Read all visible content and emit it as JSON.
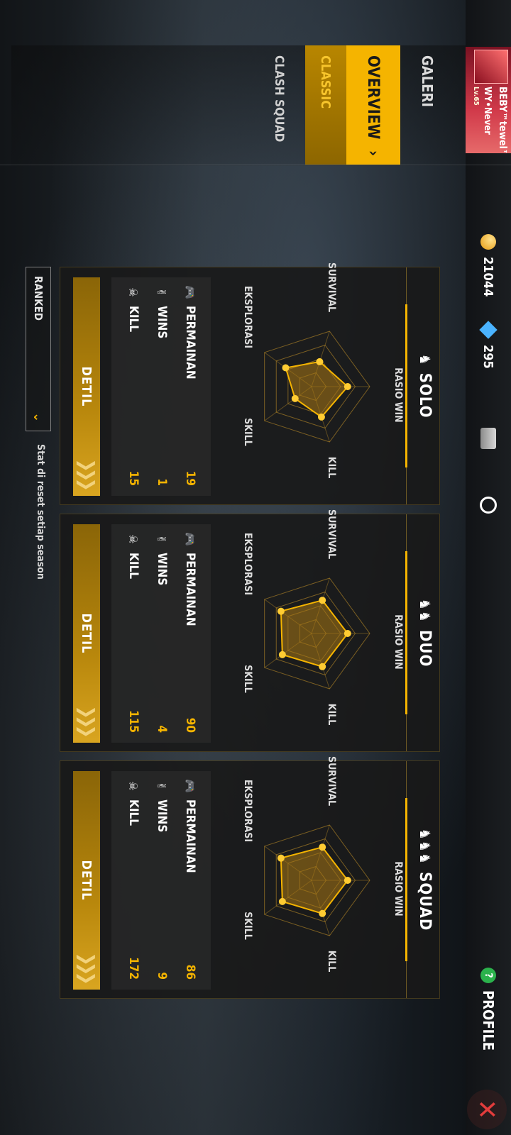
{
  "nav": {
    "galeri": "GALERI",
    "overview": "OVERVIEW",
    "classic": "CLASSIC",
    "clash_squad": "CLASH SQUAD"
  },
  "header": {
    "player_name": "BEBY™tewel™",
    "guild_name": "WY•Never",
    "level": "Lv.65",
    "gold": "21044",
    "diamonds": "295",
    "profile_label": "PROFILE"
  },
  "modes": [
    {
      "title": "SOLO",
      "radar_labels": {
        "top": "RASIO WIN",
        "right": "KILL",
        "bottom_right": "SKILL",
        "bottom_left": "EKSPLORASI",
        "left": "SURVIVAL"
      },
      "radar_values": [
        0.62,
        0.55,
        0.35,
        0.55,
        0.45
      ],
      "stats": {
        "games_label": "PERMAINAN",
        "games": "19",
        "wins_label": "WINS",
        "wins": "1",
        "kill_label": "KILL",
        "kills": "15"
      },
      "detail_label": "DETIL"
    },
    {
      "title": "DUO",
      "radar_labels": {
        "top": "RASIO WIN",
        "right": "KILL",
        "bottom_right": "SKILL",
        "bottom_left": "EKSPLORASI",
        "left": "SURVIVAL"
      },
      "radar_values": [
        0.62,
        0.6,
        0.62,
        0.65,
        0.6
      ],
      "stats": {
        "games_label": "PERMAINAN",
        "games": "90",
        "wins_label": "WINS",
        "wins": "4",
        "kill_label": "KILL",
        "kills": "115"
      },
      "detail_label": "DETIL"
    },
    {
      "title": "SQUAD",
      "radar_labels": {
        "top": "RASIO WIN",
        "right": "KILL",
        "bottom_right": "SKILL",
        "bottom_left": "EKSPLORASI",
        "left": "SURVIVAL"
      },
      "radar_values": [
        0.62,
        0.6,
        0.62,
        0.65,
        0.6
      ],
      "stats": {
        "games_label": "PERMAINAN",
        "games": "86",
        "wins_label": "WINS",
        "wins": "9",
        "kill_label": "KILL",
        "kills": "172"
      },
      "detail_label": "DETIL"
    }
  ],
  "ranked": {
    "label": "RANKED"
  },
  "reset_note": "Stat di reset setiap season",
  "colors": {
    "accent": "#f5b400",
    "panel": "#181818"
  }
}
